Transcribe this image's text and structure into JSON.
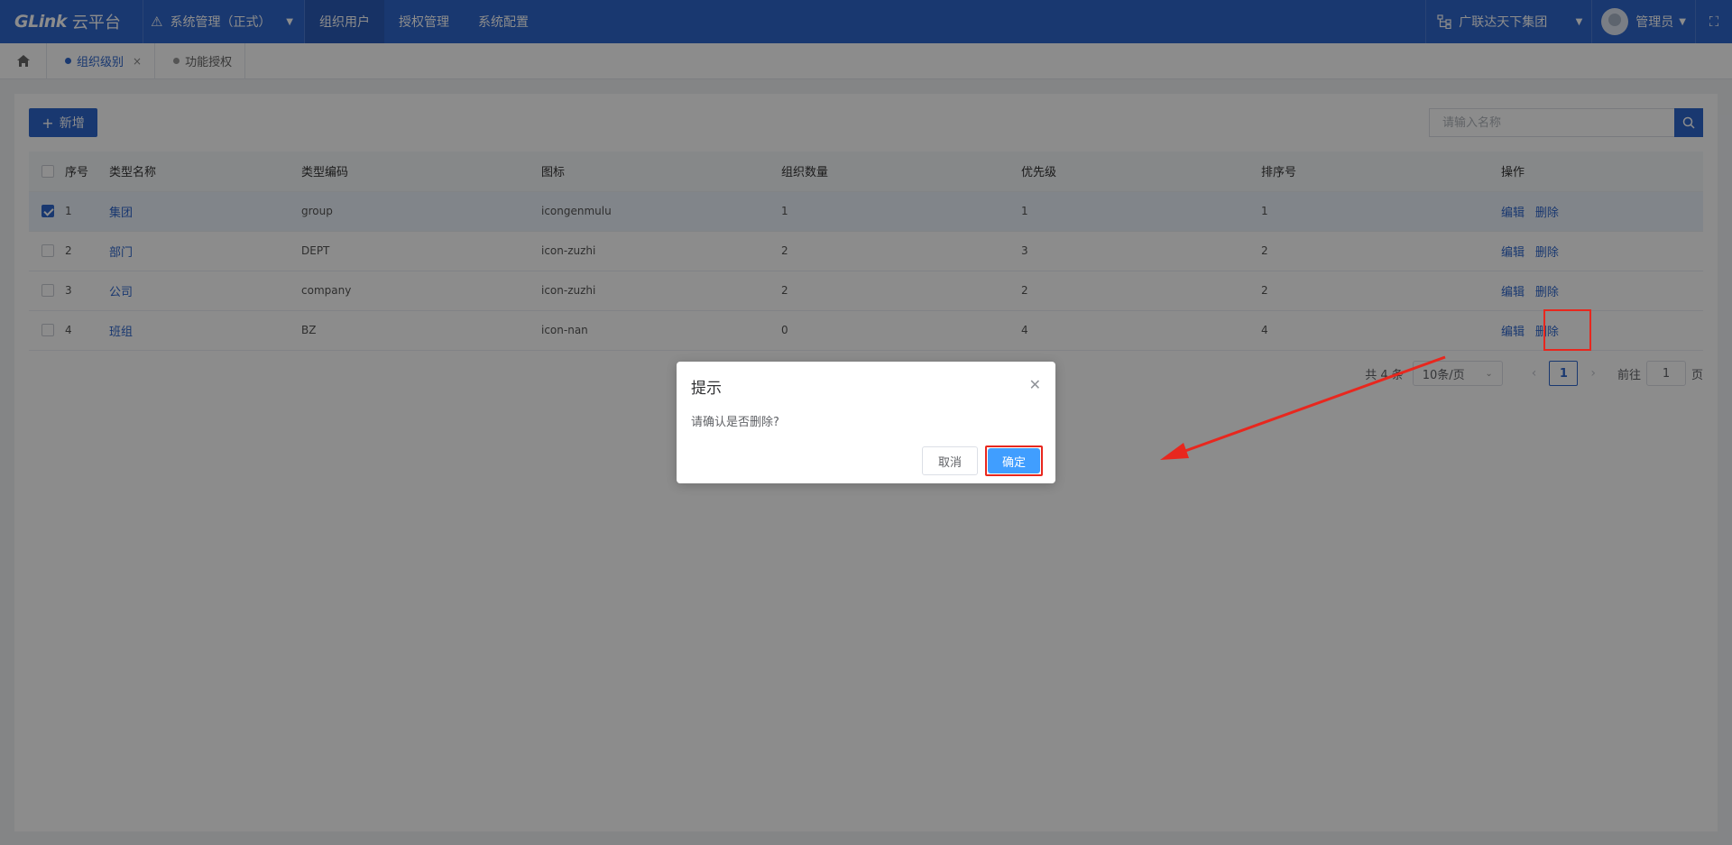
{
  "topbar": {
    "logo_brand": "GLink",
    "logo_cn": "云平台",
    "system_switch": "系统管理（正式）",
    "nav": [
      "组织用户",
      "授权管理",
      "系统配置"
    ],
    "active_nav": "组织用户",
    "org_switch": "广联达天下集团",
    "user_name": "管理员",
    "bg_color": "#2f66cc"
  },
  "tabs": [
    {
      "label": "组织级别",
      "active": true
    },
    {
      "label": "功能授权",
      "active": false
    }
  ],
  "toolbar": {
    "add_label": "新增",
    "search_placeholder": "请输入名称"
  },
  "table": {
    "columns": [
      "序号",
      "类型名称",
      "类型编码",
      "图标",
      "组织数量",
      "优先级",
      "排序号",
      "操作"
    ],
    "rows": [
      {
        "no": "1",
        "name": "集团",
        "code": "group",
        "icon": "icongenmulu",
        "count": "1",
        "priority": "1",
        "sort": "1",
        "selected": true
      },
      {
        "no": "2",
        "name": "部门",
        "code": "DEPT",
        "icon": "icon-zuzhi",
        "count": "2",
        "priority": "3",
        "sort": "2",
        "selected": false
      },
      {
        "no": "3",
        "name": "公司",
        "code": "company",
        "icon": "icon-zuzhi",
        "count": "2",
        "priority": "2",
        "sort": "2",
        "selected": false
      },
      {
        "no": "4",
        "name": "班组",
        "code": "BZ",
        "icon": "icon-nan",
        "count": "0",
        "priority": "4",
        "sort": "4",
        "selected": false
      }
    ],
    "edit_label": "编辑",
    "delete_label": "删除"
  },
  "pager": {
    "total": "共 4 条",
    "page_size": "10条/页",
    "current_page": "1",
    "goto_prefix": "前往",
    "goto_value": "1",
    "goto_suffix": "页"
  },
  "dialog": {
    "title": "提示",
    "message": "请确认是否删除?",
    "cancel_label": "取消",
    "confirm_label": "确定"
  },
  "annotation_color": "#e8271e"
}
